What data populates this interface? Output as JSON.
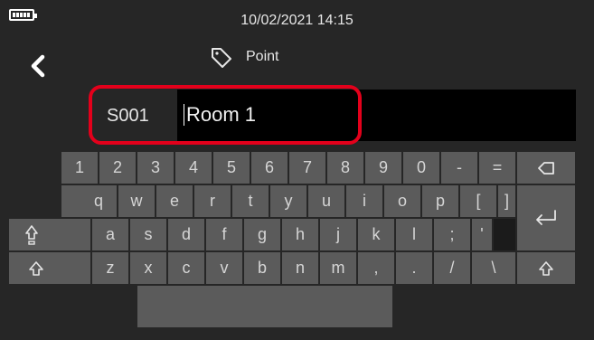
{
  "status": {
    "datetime": "10/02/2021  14:15"
  },
  "header": {
    "title": "Point"
  },
  "field": {
    "prefix": "S001",
    "value": "Room 1"
  },
  "colors": {
    "highlight": "#e3001b",
    "key": "#5b5b5b",
    "background": "#262626"
  },
  "keyboard": {
    "row1": [
      "1",
      "2",
      "3",
      "4",
      "5",
      "6",
      "7",
      "8",
      "9",
      "0",
      "-",
      "="
    ],
    "row2": [
      "q",
      "w",
      "e",
      "r",
      "t",
      "y",
      "u",
      "i",
      "o",
      "p",
      "[",
      "]"
    ],
    "row3": [
      "a",
      "s",
      "d",
      "f",
      "g",
      "h",
      "j",
      "k",
      "l",
      ";",
      "'"
    ],
    "row4": [
      "z",
      "x",
      "c",
      "v",
      "b",
      "n",
      "m",
      ",",
      ".",
      "/",
      "\\"
    ],
    "icons": {
      "backspace": "backspace-icon",
      "enter": "enter-icon",
      "capslock": "caps-lock-icon",
      "shift": "shift-icon"
    }
  }
}
